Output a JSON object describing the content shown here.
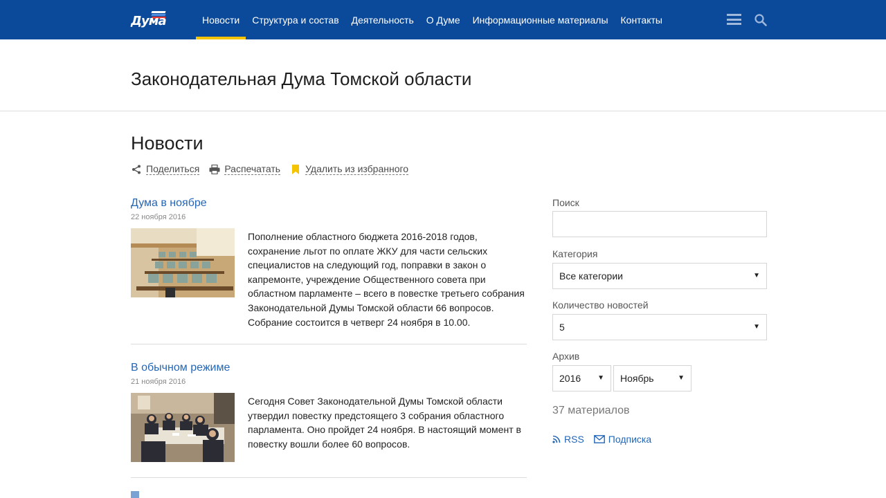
{
  "header": {
    "logo_text": "Дума",
    "nav": [
      {
        "label": "Новости",
        "active": true
      },
      {
        "label": "Структура и состав",
        "active": false
      },
      {
        "label": "Деятельность",
        "active": false
      },
      {
        "label": "О Думе",
        "active": false
      },
      {
        "label": "Информационные материалы",
        "active": false
      },
      {
        "label": "Контакты",
        "active": false
      }
    ],
    "icons": [
      "menu-icon",
      "search-icon"
    ]
  },
  "org_title": "Законодательная Дума Томской области",
  "page_title": "Новости",
  "actions": {
    "share": "Поделиться",
    "print": "Распечатать",
    "favorite": "Удалить из избранного"
  },
  "news": [
    {
      "title": "Дума в ноябре",
      "date": "22 ноября 2016",
      "text": "Пополнение областного бюджета 2016-2018 годов, сохранение льгот по оплате ЖКУ для части сельских специалистов на следующий год, поправки в закон о капремонте, учреждение Общественного совета при областном парламенте – всего в повестке третьего собрания Законодательной Думы Томской области 66 вопросов. Собрание состоится в четверг 24 ноября в 10.00."
    },
    {
      "title": "В обычном режиме",
      "date": "21 ноября 2016",
      "text": "Сегодня Совет Законодательной Думы Томской области утвердил повестку предстоящего 3 собрания областного парламента. Оно пройдет 24 ноября. В настоящий момент в повестку вошли более 60 вопросов."
    }
  ],
  "sidebar": {
    "search_label": "Поиск",
    "search_value": "",
    "category_label": "Категория",
    "category_value": "Все категории",
    "count_label": "Количество новостей",
    "count_value": "5",
    "archive_label": "Архив",
    "archive_year": "2016",
    "archive_month": "Ноябрь",
    "materials": "37 материалов",
    "rss": "RSS",
    "subscribe": "Подписка"
  },
  "colors": {
    "nav_bg": "#0b4a9b",
    "nav_active": "#f5c400",
    "link": "#2266b8"
  }
}
